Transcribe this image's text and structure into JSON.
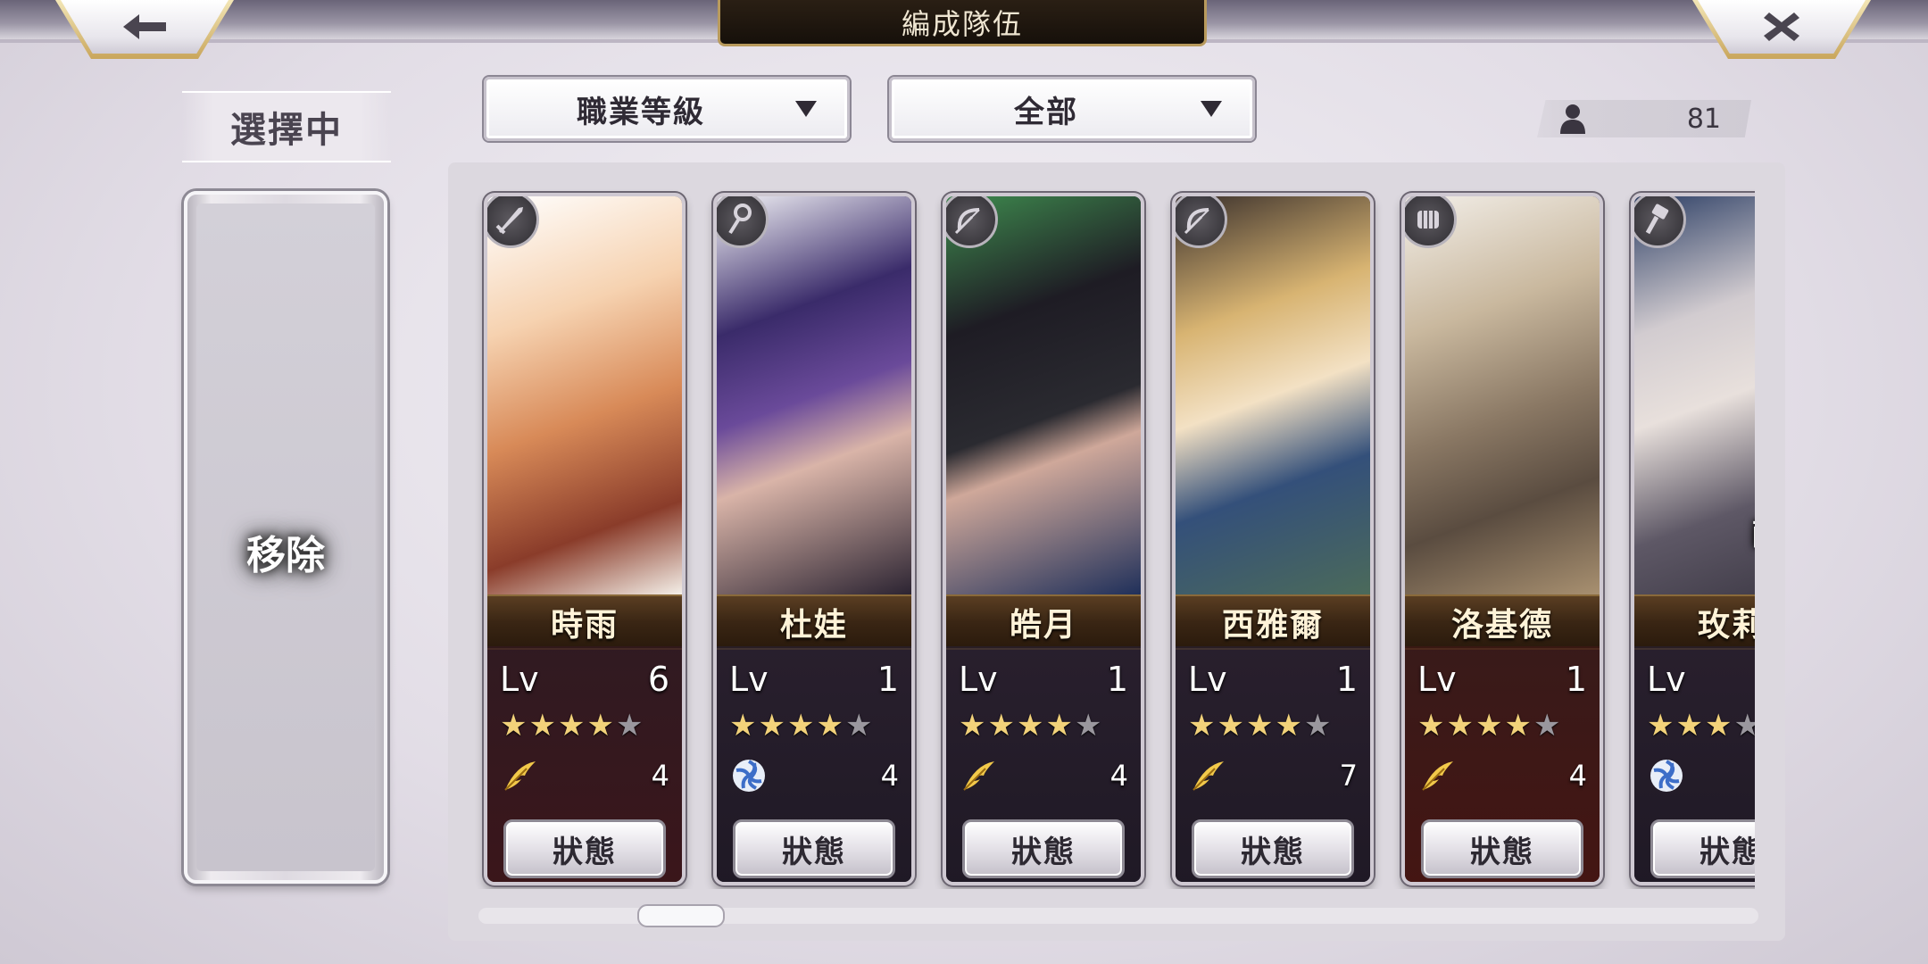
{
  "header": {
    "title": "編成隊伍"
  },
  "left": {
    "selecting_label": "選擇中",
    "remove_label": "移除"
  },
  "filters": {
    "sort_label": "職業等級",
    "type_label": "全部"
  },
  "unit_count": "81",
  "characters": [
    {
      "name": "時雨",
      "lv_label": "Lv",
      "level": "6",
      "stars": 4,
      "max_stars": 5,
      "cost": "4",
      "class_icon": "sword-icon",
      "element_icon": "wind-feather-icon",
      "status_label": "狀態",
      "palette": "c0"
    },
    {
      "name": "杜娃",
      "lv_label": "Lv",
      "level": "1",
      "stars": 4,
      "max_stars": 5,
      "cost": "4",
      "class_icon": "staff-icon",
      "element_icon": "water-swirl-icon",
      "status_label": "狀態",
      "palette": "c1"
    },
    {
      "name": "皓月",
      "lv_label": "Lv",
      "level": "1",
      "stars": 4,
      "max_stars": 5,
      "cost": "4",
      "class_icon": "bow-icon",
      "element_icon": "wind-feather-icon",
      "status_label": "狀態",
      "palette": "c2"
    },
    {
      "name": "西雅爾",
      "lv_label": "Lv",
      "level": "1",
      "stars": 4,
      "max_stars": 5,
      "cost": "7",
      "class_icon": "bow-icon",
      "element_icon": "wind-feather-icon",
      "status_label": "狀態",
      "palette": "c3"
    },
    {
      "name": "洛基德",
      "lv_label": "Lv",
      "level": "1",
      "stars": 4,
      "max_stars": 5,
      "cost": "4",
      "class_icon": "fist-icon",
      "element_icon": "wind-feather-icon",
      "status_label": "狀態",
      "palette": "c4"
    },
    {
      "name": "玫莉",
      "lv_label": "Lv",
      "level": "",
      "stars": 3,
      "max_stars": 5,
      "cost": "",
      "class_icon": "hammer-icon",
      "element_icon": "water-swirl-icon",
      "status_label": "狀態",
      "palette": "c5",
      "badge": "配置中"
    }
  ],
  "colors": {
    "star_on": "#f2d27a",
    "star_off": "#9a979e",
    "gold_trim": "#b89a5c"
  }
}
